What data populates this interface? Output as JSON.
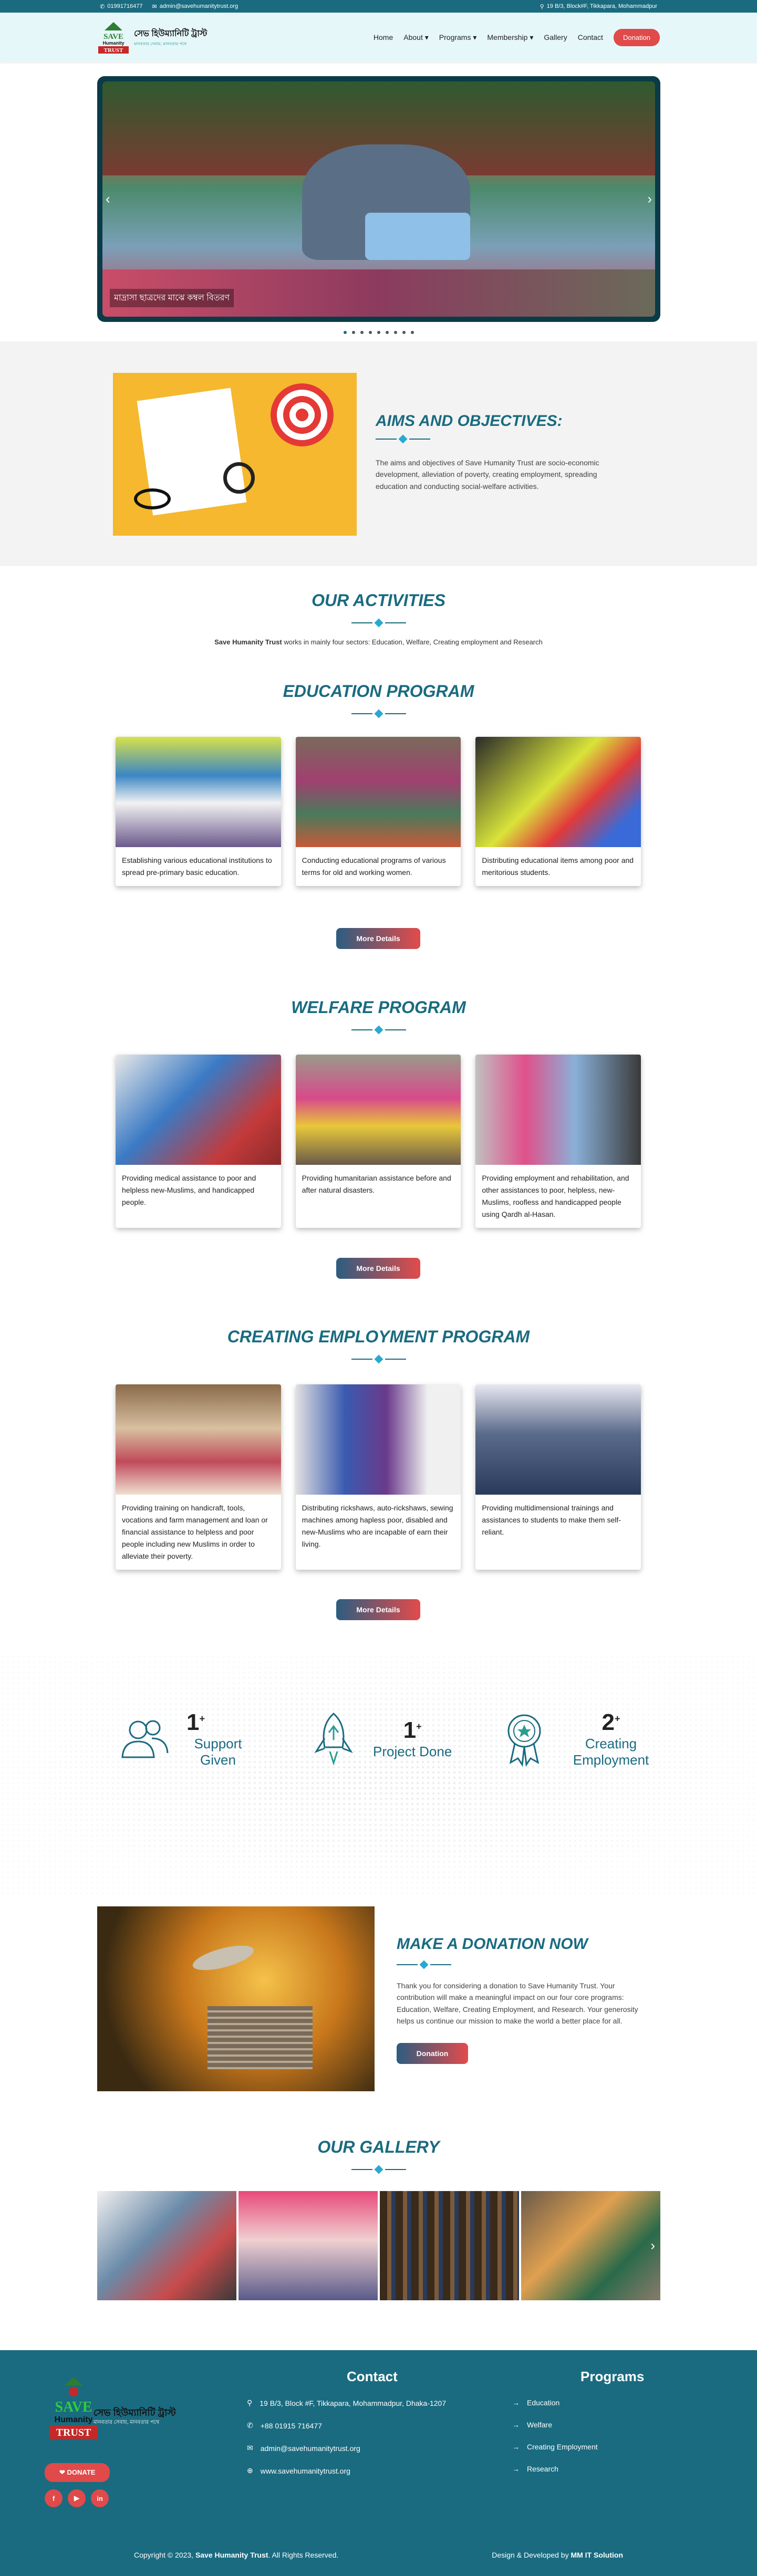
{
  "topbar": {
    "phone": "01991716477",
    "email": "admin@savehumanitytrust.org",
    "address": "19 B/3, Block#F, Tikkapara, Mohammadpur"
  },
  "brand": {
    "logo_word_top": "SAVE",
    "logo_word_mid": "Humanity",
    "logo_word_bottom": "TRUST",
    "name_bn": "সেভ হিউম্যানিটি ট্রাস্ট",
    "tagline_bn": "মানবতার সেবায়, মানবতার পথে"
  },
  "nav": {
    "items": [
      "Home",
      "About",
      "Programs",
      "Membership",
      "Gallery",
      "Contact"
    ],
    "donate": "Donation"
  },
  "hero": {
    "caption": "মাদ্রাসা ছাত্রদের মাঝে কম্বল বিতরণ",
    "prev": "‹",
    "next": "›",
    "slide_count": 9,
    "active_slide": 0
  },
  "aims": {
    "title": "AIMS AND OBJECTIVES:",
    "text": "The aims and objectives of Save Humanity Trust are socio-economic development, alleviation of poverty, creating employment, spreading education and conducting social-welfare activities."
  },
  "activities": {
    "title": "OUR ACTIVITIES",
    "subtitle_bold": "Save Humanity Trust",
    "subtitle_rest": " works in mainly four sectors: Education, Welfare, Creating employment and Research"
  },
  "programs": [
    {
      "title": "EDUCATION PROGRAM",
      "more": "More Details",
      "cards": [
        "Establishing various educational institutions to spread pre-primary basic education.",
        "Conducting educational programs of various terms for old and working women.",
        "Distributing educational items among poor and meritorious students."
      ]
    },
    {
      "title": "WELFARE PROGRAM",
      "more": "More Details",
      "cards": [
        "Providing medical assistance to poor and helpless new-Muslims, and handicapped people.",
        "Providing humanitarian assistance before and after natural disasters.",
        "Providing employment and rehabilitation, and other assistances to poor, helpless, new-Muslims, roofless and handicapped people using Qardh al-Hasan."
      ]
    },
    {
      "title": "CREATING EMPLOYMENT PROGRAM",
      "more": "More Details",
      "cards": [
        "Providing training on handicraft, tools, vocations and farm management and loan or financial assistance to helpless and poor people including new Muslims in order to alleviate their poverty.",
        "Distributing rickshaws, auto-rickshaws, sewing machines among hapless poor, disabled and new-Muslims who are incapable of earn their living.",
        "Providing multidimensional trainings and assistances to students to make them self-reliant."
      ]
    }
  ],
  "stats": [
    {
      "icon": "users-icon",
      "value": "1",
      "suffix": "+",
      "label": "Support Given"
    },
    {
      "icon": "rocket-icon",
      "value": "1",
      "suffix": "+",
      "label": "Project Done"
    },
    {
      "icon": "award-icon",
      "value": "2",
      "suffix": "+",
      "label": "Creating Employment"
    }
  ],
  "donation": {
    "title": "MAKE A DONATION NOW",
    "text": "Thank you for considering a donation to Save Humanity Trust. Your contribution will make a meaningful impact on our four core programs: Education, Welfare, Creating Employment, and Research. Your generosity helps us continue our mission to make the world a better place for all.",
    "button": "Donation"
  },
  "gallery": {
    "title": "OUR GALLERY",
    "next": "›"
  },
  "footer": {
    "donate": "DONATE",
    "social": [
      "f",
      "▶",
      "in"
    ],
    "contact_title": "Contact",
    "address": "19 B/3, Block #F, Tikkapara, Mohammadpur, Dhaka-1207",
    "phone": "+88 01915 716477",
    "email": "admin@savehumanitytrust.org",
    "web": "www.savehumanitytrust.org",
    "programs_title": "Programs",
    "programs": [
      "Education",
      "Welfare",
      "Creating Employment",
      "Research"
    ],
    "copyright_pre": "Copyright © 2023, ",
    "copyright_bold": "Save Humanity Trust",
    "copyright_post": ". All Rights Reserved.",
    "credit_pre": "Design & Developed by ",
    "credit_bold": "MM IT Solution"
  },
  "colors": {
    "primary": "#1a6b80",
    "accent": "#e04a4a"
  }
}
